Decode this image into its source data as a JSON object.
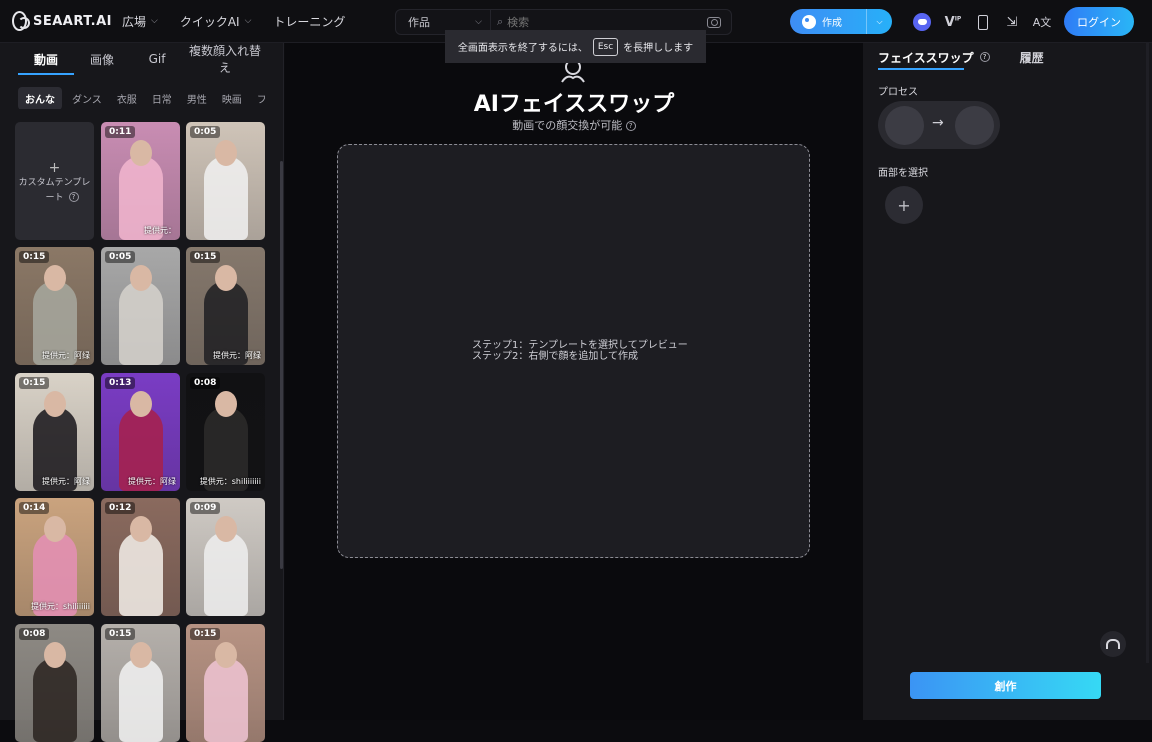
{
  "header": {
    "logo_text": "SEAART.AI",
    "nav": [
      {
        "label": "広場",
        "has_dropdown": true
      },
      {
        "label": "クイックAI",
        "has_dropdown": true
      },
      {
        "label": "トレーニング",
        "has_dropdown": false
      }
    ],
    "search": {
      "scope": "作品",
      "placeholder": "検索"
    },
    "create_label": "作成",
    "login_label": "ログイン",
    "icons": [
      "discord-icon",
      "vip-icon",
      "phone-icon",
      "download-icon",
      "translate-icon"
    ]
  },
  "toast": {
    "before": "全画面表示を終了するには、",
    "key": "Esc",
    "after": "を長押しします"
  },
  "left": {
    "tabs": [
      "動画",
      "画像",
      "Gif",
      "複数顔入れ替え"
    ],
    "active_tab": "動画",
    "categories": [
      "おんな",
      "ダンス",
      "衣服",
      "日常",
      "男性",
      "映画",
      "フ"
    ],
    "active_category": "おんな",
    "custom_template": "カスタムテンプレート",
    "cards": [
      {
        "duration": "0:11",
        "credit": "提供元：",
        "bg": "#c98db3",
        "figure": "#f2b6cf"
      },
      {
        "duration": "0:05",
        "credit": "",
        "bg": "#cfc4b8",
        "figure": "#f1f1f1"
      },
      {
        "duration": "0:15",
        "credit": "提供元：阿绿",
        "bg": "#8b7866",
        "figure": "#a7a89f"
      },
      {
        "duration": "0:05",
        "credit": "",
        "bg": "#a8a8a8",
        "figure": "#d6d2cc"
      },
      {
        "duration": "0:15",
        "credit": "提供元：阿绿",
        "bg": "#85786c",
        "figure": "#1f1e22"
      },
      {
        "duration": "0:15",
        "credit": "提供元：阿绿",
        "bg": "#d9d2c7",
        "figure": "#17151a"
      },
      {
        "duration": "0:13",
        "credit": "提供元：阿绿",
        "bg": "#7a3cc4",
        "figure": "#a8204a"
      },
      {
        "duration": "0:08",
        "credit": "提供元：shiliiiiiii",
        "bg": "#111113",
        "figure": "#2d2c2a"
      },
      {
        "duration": "0:14",
        "credit": "提供元：shiliiiiii",
        "bg": "#caa37e",
        "figure": "#e58fb6"
      },
      {
        "duration": "0:12",
        "credit": "",
        "bg": "#8a6a5e",
        "figure": "#f4f0ea"
      },
      {
        "duration": "0:09",
        "credit": "",
        "bg": "#cfcac4",
        "figure": "#eeeeee"
      },
      {
        "duration": "0:08",
        "credit": "",
        "bg": "#8e8a84",
        "figure": "#2a2320"
      },
      {
        "duration": "0:15",
        "credit": "",
        "bg": "#b5b0ab",
        "figure": "#f2f2f2"
      },
      {
        "duration": "0:15",
        "credit": "",
        "bg": "#b79383",
        "figure": "#f0c4d4"
      }
    ]
  },
  "center": {
    "title": "AIフェイススワップ",
    "subtitle": "動画での顔交換が可能",
    "step1": "ステップ1：テンプレートを選択してプレビュー",
    "step2": "ステップ2：右側で顔を追加して作成"
  },
  "right": {
    "tab_active": "フェイススワップ",
    "tab_history": "履歴",
    "process_label": "プロセス",
    "select_face_label": "面部を選択",
    "create_label": "創作"
  }
}
